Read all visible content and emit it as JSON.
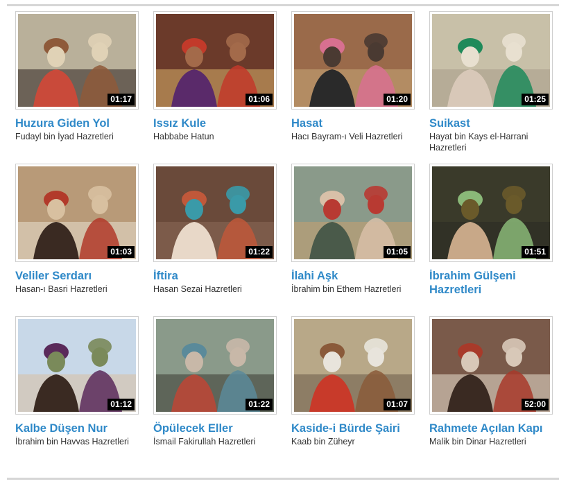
{
  "videos": [
    {
      "title": "Huzura Giden Yol",
      "subtitle": "Fudayl bin İyad Hazretleri",
      "duration": "01:17",
      "thumb_icon": "turbaned-man-desert-scene",
      "colors": [
        "#b9b09a",
        "#e0d2b6",
        "#8e5a3a",
        "#c94a3a",
        "#2d2320"
      ]
    },
    {
      "title": "Issız Kule",
      "subtitle": "Habbabe Hatun",
      "duration": "01:06",
      "thumb_icon": "bearded-man-purple-robe-scene",
      "colors": [
        "#6b3a2a",
        "#a36a4a",
        "#c23a2a",
        "#5a2a6a",
        "#d8b06a"
      ]
    },
    {
      "title": "Hasat",
      "subtitle": "Hacı Bayram-ı Veli Hazretleri",
      "duration": "01:20",
      "thumb_icon": "group-of-men-market-scene",
      "colors": [
        "#9a6a4a",
        "#4a3a32",
        "#d87090",
        "#2a2a2a",
        "#c8a878"
      ]
    },
    {
      "title": "Suikast",
      "subtitle": "Hayat bin Kays el-Harrani Hazretleri",
      "duration": "01:25",
      "thumb_icon": "old-man-green-turban-scene",
      "colors": [
        "#c8c0a8",
        "#e8e0d0",
        "#1f8a5a",
        "#d8c8b8",
        "#a89a88"
      ]
    },
    {
      "title": "Veliler Serdarı",
      "subtitle": "Hasan-ı Basri Hazretleri",
      "duration": "01:03",
      "thumb_icon": "seated-scholar-reading-scene",
      "colors": [
        "#b89a78",
        "#d8c0a0",
        "#b23a2a",
        "#3a2a22",
        "#e8e0d0"
      ]
    },
    {
      "title": "İftira",
      "subtitle": "Hasan Sezai Hazretleri",
      "duration": "01:22",
      "thumb_icon": "man-teal-turban-scene",
      "colors": [
        "#6a4a3a",
        "#3a9aa8",
        "#c0583a",
        "#e8d8c8",
        "#8a6a58"
      ]
    },
    {
      "title": "İlahi Aşk",
      "subtitle": "İbrahim bin Ethem Hazretleri",
      "duration": "01:05",
      "thumb_icon": "bearded-elder-red-turban-scene",
      "colors": [
        "#8a9a8a",
        "#b83a32",
        "#d8c0a8",
        "#4a5a4a",
        "#c8a070"
      ]
    },
    {
      "title": "İbrahim Gülşeni Hazretleri",
      "subtitle": "",
      "duration": "01:51",
      "thumb_icon": "two-men-ornate-wall-scene",
      "colors": [
        "#3a3a2a",
        "#6a5a2a",
        "#8ab878",
        "#c8a888",
        "#2a2a22"
      ]
    },
    {
      "title": "Kalbe Düşen Nur",
      "subtitle": "İbrahim bin Havvas Hazretleri",
      "duration": "01:12",
      "thumb_icon": "men-in-forest-scene",
      "colors": [
        "#c8d8e8",
        "#7a8a5a",
        "#5a2a5a",
        "#3a2a22",
        "#d8c0a0"
      ]
    },
    {
      "title": "Öpülecek Eller",
      "subtitle": "İsmail Fakirullah Hazretleri",
      "duration": "01:22",
      "thumb_icon": "crowd-courtyard-scene",
      "colors": [
        "#8a9a8a",
        "#c8b8a8",
        "#5a8a9a",
        "#b04a3a",
        "#3a3a32"
      ]
    },
    {
      "title": "Kaside-i Bürde Şairi",
      "subtitle": "Kaab bin Züheyr",
      "duration": "01:07",
      "thumb_icon": "men-sitting-on-carpet-scene",
      "colors": [
        "#b8a888",
        "#e8e4dc",
        "#8a5a3a",
        "#c83a2a",
        "#6a5a48"
      ]
    },
    {
      "title": "Rahmete Açılan Kapı",
      "subtitle": "Malik bin Dinar Hazretleri",
      "duration": "52:00",
      "thumb_icon": "two-men-talking-interior-scene",
      "colors": [
        "#7a5a4a",
        "#d8c8b8",
        "#a83a2a",
        "#3a2a22",
        "#e8e0d0"
      ]
    }
  ]
}
